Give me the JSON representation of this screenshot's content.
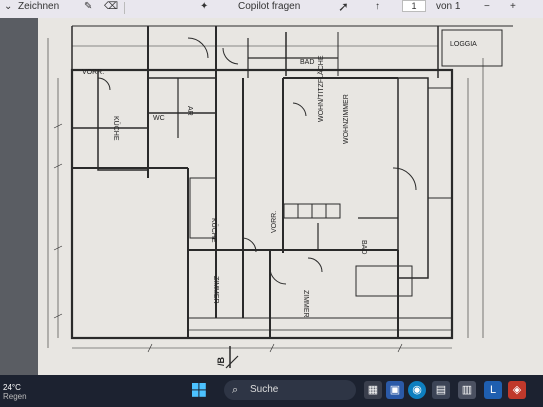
{
  "toolbar": {
    "draw_label": "Zeichnen",
    "copilot_label": "Copilot fragen",
    "page_current": "1",
    "page_total_label": "von 1"
  },
  "plan_labels": {
    "loggia": "LOGGIA",
    "bad_top": "BAD",
    "vorr_top": "VORR.",
    "kuche_top": "KÜCHE",
    "ar": "AR",
    "wc": "WC",
    "wohn_kuche": "WOHN/TITZFLÄCHE",
    "wohnzimmer": "WOHNZIMMER",
    "kuche_mid": "KÜCHE",
    "vorr_mid": "VORR.",
    "bad_mid": "BAD",
    "zimmer_left": "ZIMMER",
    "zimmer_right": "ZIMMER",
    "section_mark": "/B"
  },
  "taskbar": {
    "weather_temp": "24°C",
    "weather_cond": "Regen",
    "search_placeholder": "Suche"
  },
  "colors": {
    "taskbar": "#1c2230",
    "paper": "#e8e6e2",
    "ink": "#2a2a2a"
  }
}
